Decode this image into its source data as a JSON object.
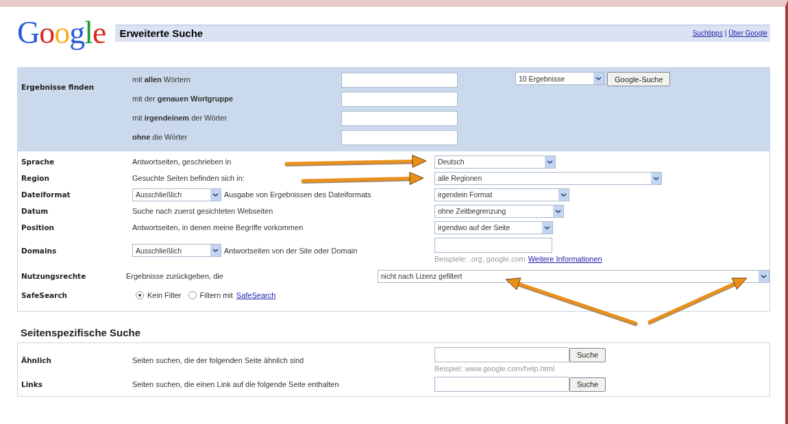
{
  "header": {
    "logo": "Google",
    "title": "Erweiterte Suche",
    "links": [
      "Suchtipps",
      "Über Google"
    ],
    "separator": "|"
  },
  "find": {
    "label": "Ergebnisse finden",
    "rows": [
      {
        "text": "mit **allen** Wörtern"
      },
      {
        "text": "mit der **genauen Wortgruppe**"
      },
      {
        "text": "mit **irgendeinem** der Wörter"
      },
      {
        "text": "**ohne** die Wörter"
      }
    ],
    "results_select": "10 Ergebnisse",
    "button": "Google-Suche"
  },
  "options": [
    {
      "kind": "select",
      "label": "Sprache",
      "text": "Antwortseiten, geschrieben in",
      "value": "Deutsch"
    },
    {
      "kind": "select",
      "label": "Region",
      "text": "Gesuchte Seiten befinden sich in:",
      "value": "alle Regionen"
    },
    {
      "kind": "mode-select",
      "label": "Dateiformat",
      "mode": "Ausschließlich",
      "text": "Ausgabe von Ergebnissen des Dateiformats",
      "value": "irgendein Format"
    },
    {
      "kind": "select",
      "label": "Datum",
      "text": "Suche nach zuerst gesichteten Webseiten",
      "value": "ohne Zeitbegrenzung"
    },
    {
      "kind": "select",
      "label": "Position",
      "text": "Antwortseiten, in denen meine Begriffe vorkommen",
      "value": "irgendwo auf der Seite"
    },
    {
      "kind": "domain",
      "label": "Domains",
      "mode": "Ausschließlich",
      "text": "Antwortseiten von der Site oder Domain",
      "hint": "Beispiele: .org, google.com",
      "link": "Weitere Informationen"
    },
    {
      "kind": "wide-select",
      "label": "Nutzungsrechte",
      "text": "Ergebnisse zurückgeben, die",
      "value": "nicht nach Lizenz gefiltert"
    },
    {
      "kind": "radios",
      "label": "SafeSearch",
      "choices": [
        {
          "label": "Kein Filter",
          "selected": true
        },
        {
          "label": "Filtern mit",
          "link": "SafeSearch",
          "selected": false
        }
      ]
    }
  ],
  "site_search": {
    "heading": "Seitenspezifische Suche",
    "rows": [
      {
        "label": "Ähnlich",
        "text": "Seiten suchen, die der folgenden Seite ähnlich sind",
        "button": "Suche",
        "hint": "Beispiel: www.google.com/help.html"
      },
      {
        "label": "Links",
        "text": "Seiten suchen, die einen Link auf die folgende Seite enthalten",
        "button": "Suche"
      }
    ]
  }
}
